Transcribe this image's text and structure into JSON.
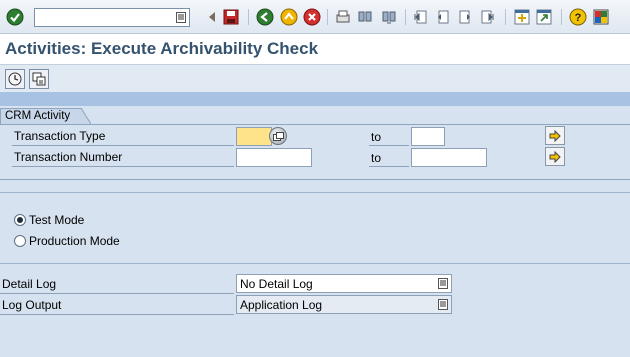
{
  "toolbar": {
    "command_field": {
      "value": "",
      "placeholder": ""
    },
    "icons": [
      "enter-icon",
      "back-triangle-icon",
      "save-icon",
      "back-icon",
      "exit-icon",
      "cancel-icon",
      "print-icon",
      "find-icon",
      "find-next-icon",
      "first-page-icon",
      "previous-page-icon",
      "next-page-icon",
      "last-page-icon",
      "new-session-icon",
      "shortcut-icon",
      "help-icon",
      "customize-layout-icon"
    ]
  },
  "page": {
    "title": "Activities: Execute Archivability Check"
  },
  "app_toolbar": {
    "icons": [
      "execute-icon",
      "get-variant-icon"
    ]
  },
  "crm_frame": {
    "tab_label": "CRM Activity",
    "rows": [
      {
        "label": "Transaction Type",
        "from_value": "",
        "to_label": "to",
        "to_value": ""
      },
      {
        "label": "Transaction Number",
        "from_value": "",
        "to_label": "to",
        "to_value": ""
      }
    ]
  },
  "mode": {
    "options": [
      {
        "label": "Test Mode",
        "selected": true
      },
      {
        "label": "Production Mode",
        "selected": false
      }
    ]
  },
  "detail_log": {
    "label": "Detail Log",
    "value": "No Detail Log"
  },
  "log_output": {
    "label": "Log Output",
    "value": "Application Log"
  },
  "colors": {
    "title": "#35536f",
    "background": "#d6e2ef",
    "required": "#ffe38a"
  }
}
